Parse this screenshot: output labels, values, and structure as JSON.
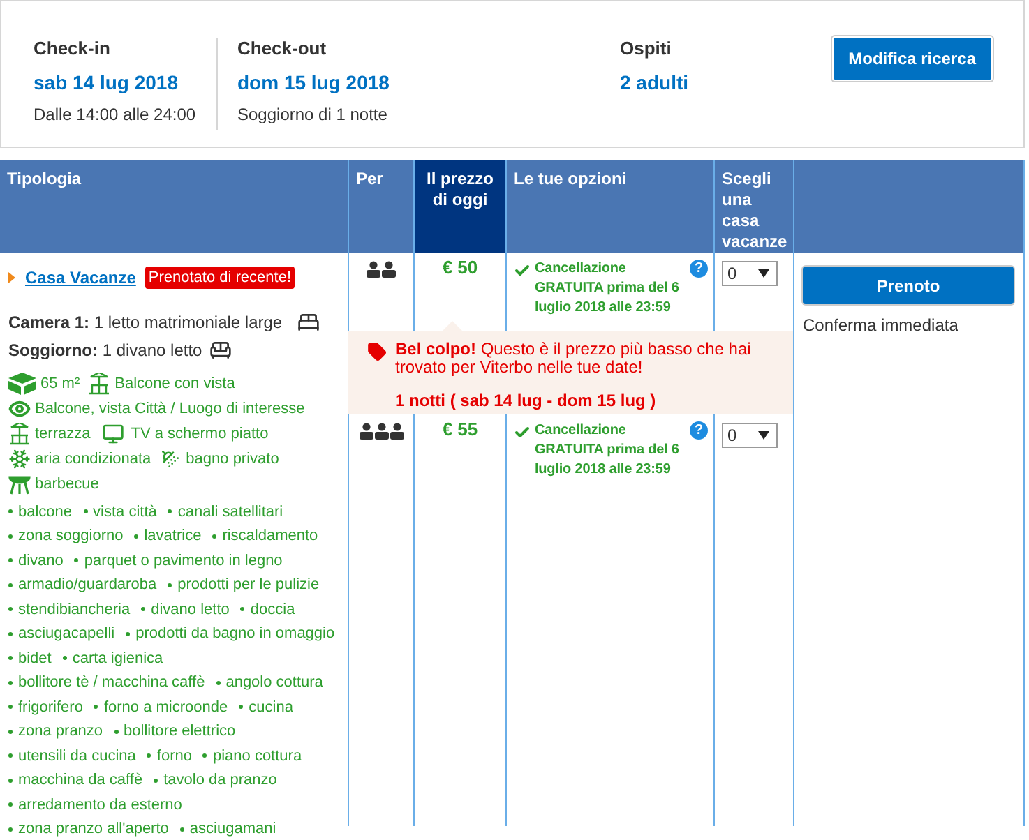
{
  "search_summary": {
    "checkin": {
      "label": "Check-in",
      "date": "sab 14 lug 2018",
      "note": "Dalle 14:00 alle 24:00"
    },
    "checkout": {
      "label": "Check-out",
      "date": "dom 15 lug 2018",
      "note": "Soggiorno di 1 notte"
    },
    "guests": {
      "label": "Ospiti",
      "value": "2 adulti"
    },
    "button": "Modifica ricerca"
  },
  "table": {
    "columns": [
      "Tipologia",
      "Per",
      "Il prezzo di oggi",
      "Le tue opzioni",
      "Scegli una casa vacanze"
    ],
    "unit": {
      "name": "Casa Vacanze",
      "badge": "Prenotato di recente!",
      "beds": [
        {
          "label": "Camera 1:",
          "text": "1 letto matrimoniale large",
          "kind": "bed"
        },
        {
          "label": "Soggiorno:",
          "text": "1 divano letto",
          "kind": "sofa"
        }
      ],
      "facility_lines": [
        [
          {
            "kind": "area",
            "text": "65 m²"
          },
          {
            "kind": "balcony",
            "text": "Balcone con vista"
          }
        ],
        [
          {
            "kind": "view",
            "text": "Balcone, vista Città / Luogo di interesse"
          }
        ],
        [
          {
            "kind": "balcony",
            "text": "terrazza"
          },
          {
            "kind": "tv",
            "text": "TV a schermo piatto"
          }
        ],
        [
          {
            "kind": "ac",
            "text": "aria condizionata"
          },
          {
            "kind": "shower",
            "text": "bagno privato"
          }
        ],
        [
          {
            "kind": "bbq",
            "text": "barbecue"
          }
        ]
      ],
      "amenity_lines": [
        [
          "balcone",
          "vista città",
          "canali satellitari"
        ],
        [
          "zona soggiorno",
          "lavatrice",
          "riscaldamento"
        ],
        [
          "divano",
          "parquet o pavimento in legno"
        ],
        [
          "armadio/guardaroba",
          "prodotti per le pulizie"
        ],
        [
          "stendibiancheria",
          "divano letto",
          "doccia"
        ],
        [
          "asciugacapelli",
          "prodotti da bagno in omaggio"
        ],
        [
          "bidet",
          "carta igienica"
        ],
        [
          "bollitore tè / macchina caffè",
          "angolo cottura"
        ],
        [
          "frigorifero",
          "forno a microonde",
          "cucina"
        ],
        [
          "zona pranzo",
          "bollitore elettrico"
        ],
        [
          "utensili da cucina",
          "forno",
          "piano cottura"
        ],
        [
          "macchina da caffè",
          "tavolo da pranzo"
        ],
        [
          "arredamento da esterno"
        ],
        [
          "zona pranzo all'aperto",
          "asciugamani"
        ]
      ]
    },
    "rows": [
      {
        "kind": "double",
        "price": "€ 50",
        "option": "Cancellazione GRATUITA prima del 6 luglio 2018 alle 23:59",
        "help": "?",
        "quantity": "0"
      },
      {
        "kind": "triple",
        "price": "€ 55",
        "option": "Cancellazione GRATUITA prima del 6 luglio 2018 alle 23:59",
        "help": "?",
        "quantity": "0"
      }
    ],
    "deal": {
      "text": "**Bel colpo!** Questo è il prezzo più basso che hai trovato per Viterbo nelle tue date!",
      "nights": "1 notti ( sab 14 lug - dom 15 lug )"
    },
    "action": {
      "button": "Prenoto",
      "note": "Conferma immediata"
    }
  }
}
